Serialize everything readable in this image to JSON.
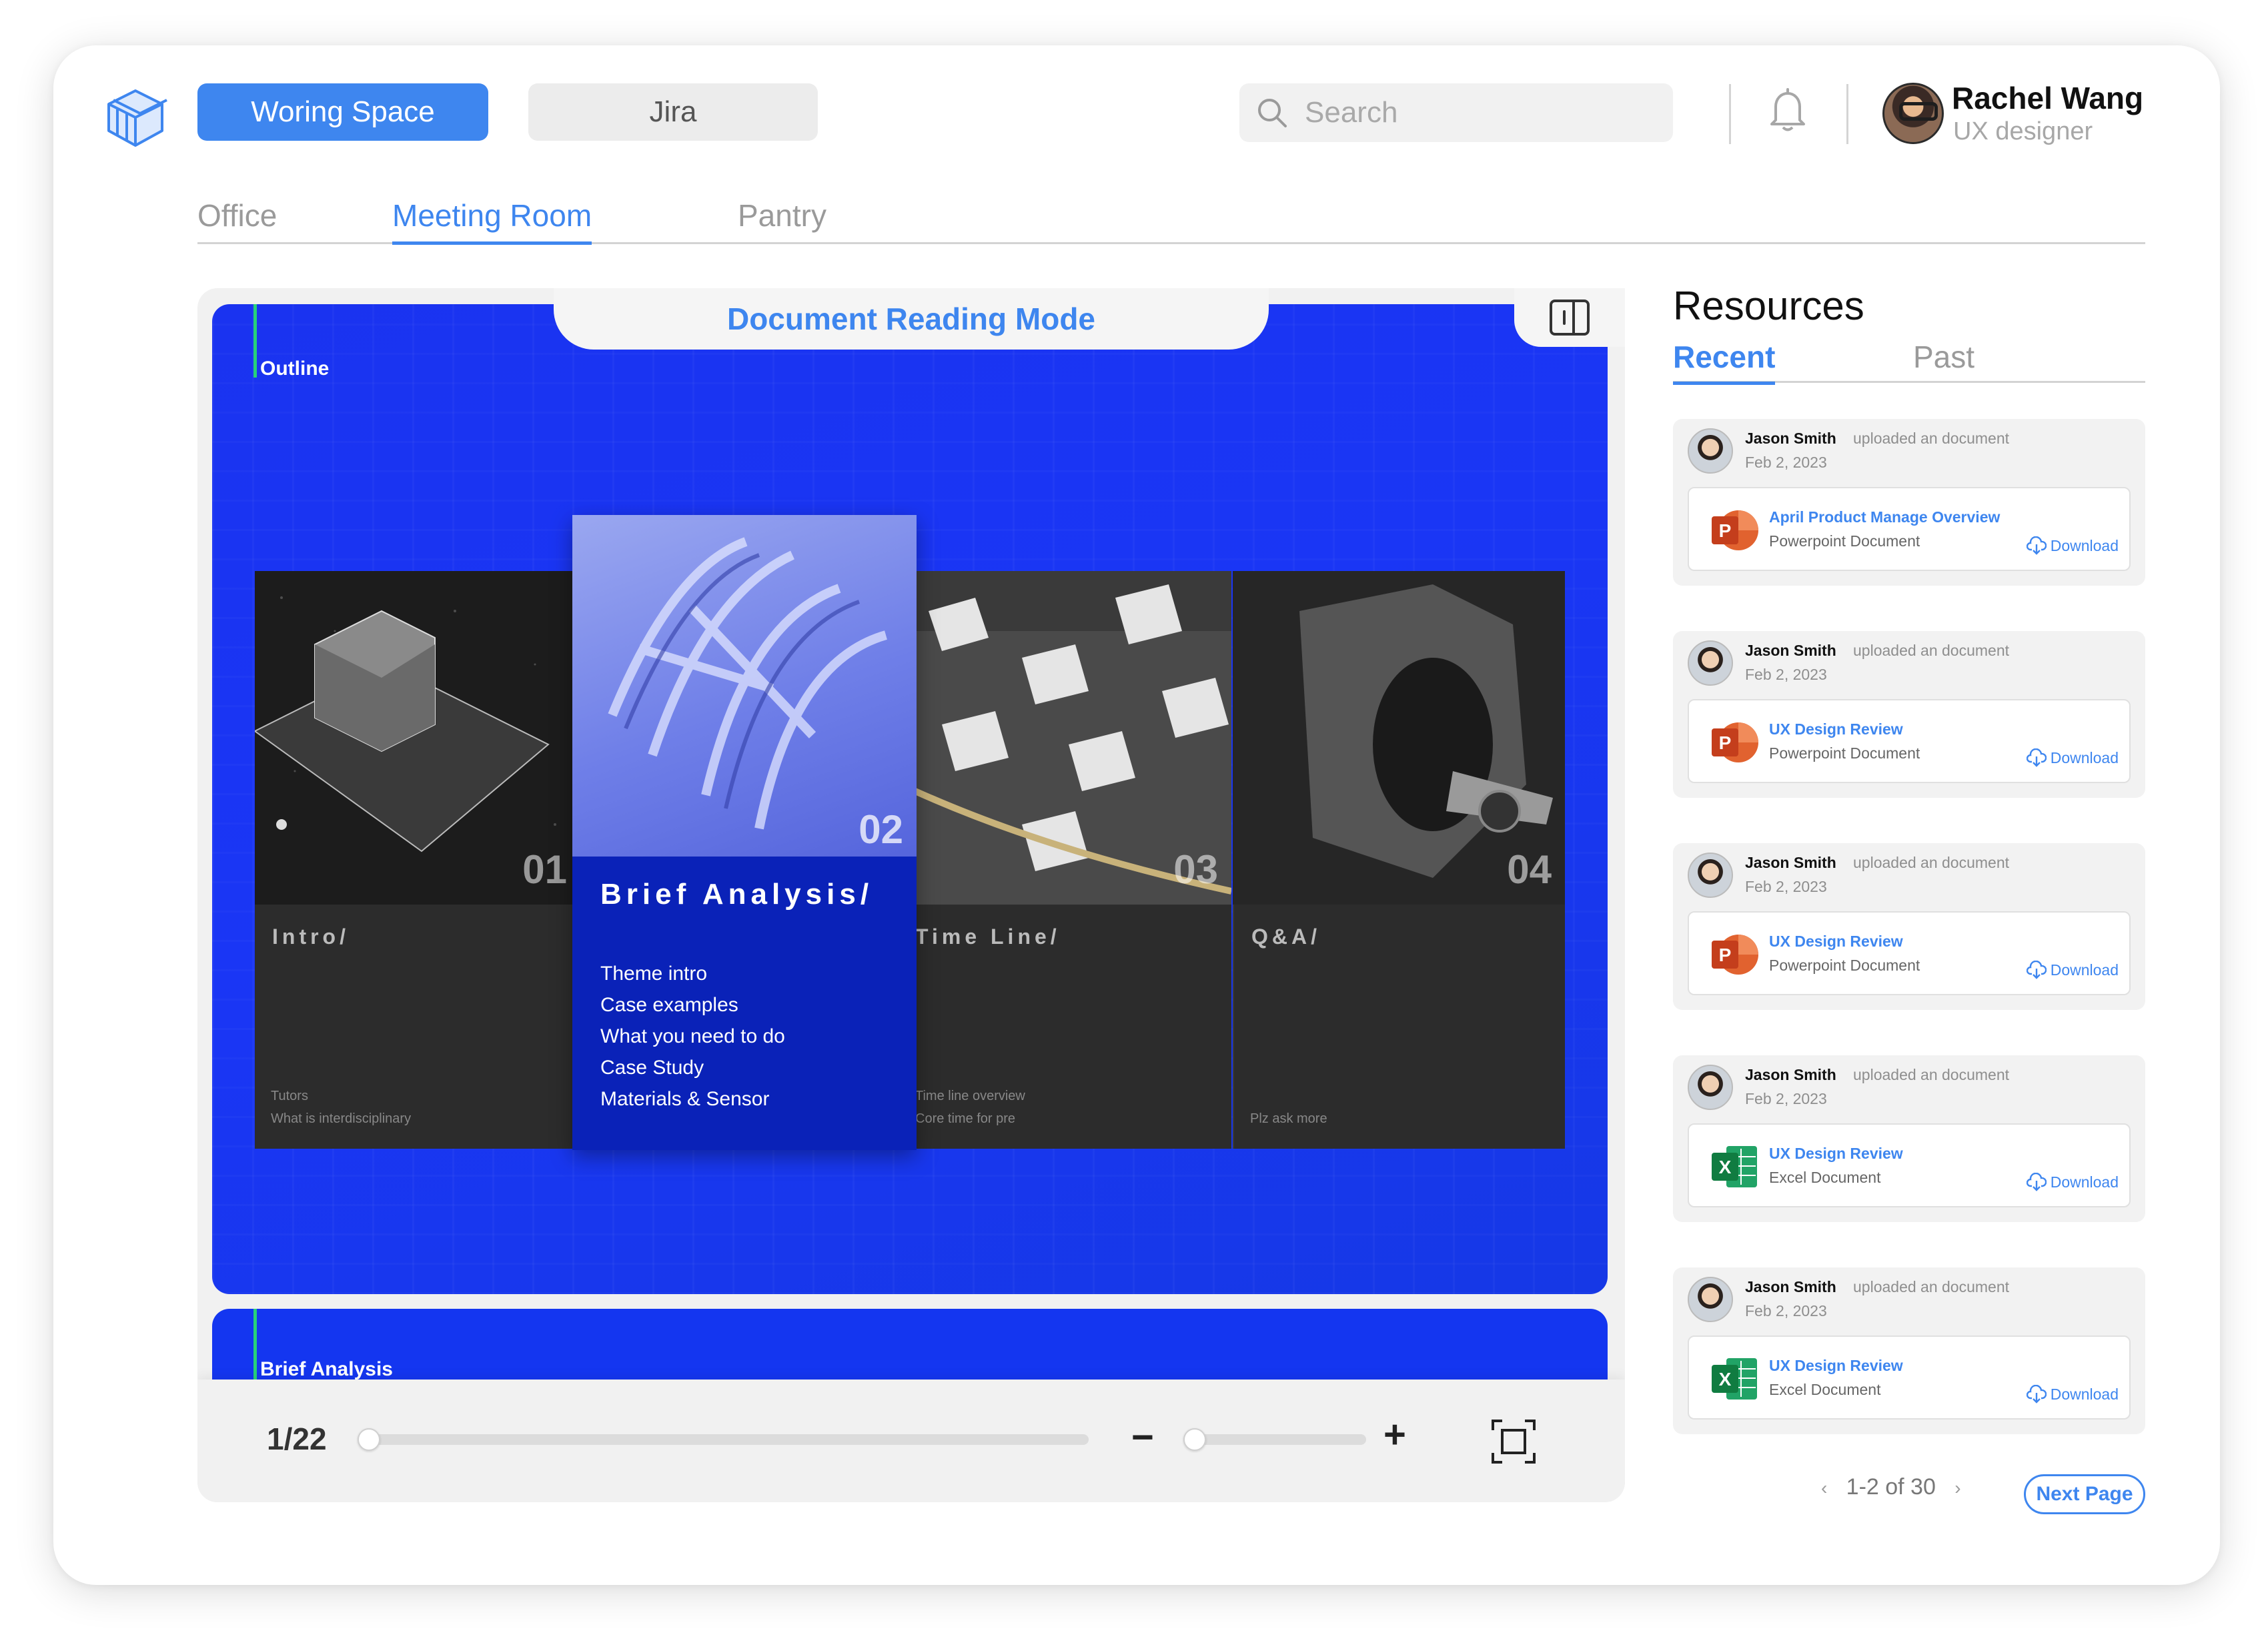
{
  "header": {
    "workspace_label": "Woring Space",
    "jira_label": "Jira",
    "search_placeholder": "Search",
    "user": {
      "name": "Rachel Wang",
      "role": "UX designer"
    }
  },
  "nav": {
    "tabs": [
      {
        "label": "Office",
        "active": false
      },
      {
        "label": "Meeting Room",
        "active": true
      },
      {
        "label": "Pantry",
        "active": false
      }
    ]
  },
  "viewer": {
    "mode_title": "Document Reading Mode",
    "slide1": {
      "outline_label": "Outline",
      "panels": [
        {
          "num": "01",
          "title": "Intro/",
          "lines": [
            "Tutors",
            "What is interdisciplinary"
          ]
        },
        {
          "num": "02",
          "title": "Brief Analysis/",
          "lines": [
            "Theme intro",
            "Case examples",
            "What you need to do",
            "Case Study",
            "Materials & Sensor"
          ]
        },
        {
          "num": "03",
          "title": "Time Line/",
          "lines": [
            "Time line overview",
            "Core time for pre"
          ]
        },
        {
          "num": "04",
          "title": "Q&A/",
          "lines": [
            "Plz ask more"
          ]
        }
      ]
    },
    "slide2_label": "Brief Analysis",
    "controls": {
      "page_indicator": "1/22",
      "progress": 0.0,
      "zoom": 0.0
    }
  },
  "resources": {
    "title": "Resources",
    "tabs": [
      {
        "label": "Recent",
        "active": true
      },
      {
        "label": "Past",
        "active": false
      }
    ],
    "items": [
      {
        "user": "Jason Smith",
        "action": "uploaded an document",
        "date": "Feb 2, 2023",
        "doc_title": "April Product Manage Overview",
        "doc_type": "Powerpoint Document",
        "icon": "powerpoint-icon",
        "download": "Download"
      },
      {
        "user": "Jason Smith",
        "action": "uploaded an document",
        "date": "Feb 2, 2023",
        "doc_title": "UX Design Review",
        "doc_type": "Powerpoint Document",
        "icon": "powerpoint-icon",
        "download": "Download"
      },
      {
        "user": "Jason Smith",
        "action": "uploaded an document",
        "date": "Feb 2, 2023",
        "doc_title": "UX Design Review",
        "doc_type": "Powerpoint Document",
        "icon": "powerpoint-icon",
        "download": "Download"
      },
      {
        "user": "Jason Smith",
        "action": "uploaded an document",
        "date": "Feb 2, 2023",
        "doc_title": "UX Design Review",
        "doc_type": "Excel Document",
        "icon": "excel-icon",
        "download": "Download"
      },
      {
        "user": "Jason Smith",
        "action": "uploaded an document",
        "date": "Feb 2, 2023",
        "doc_title": "UX Design Review",
        "doc_type": "Excel Document",
        "icon": "excel-icon",
        "download": "Download"
      }
    ],
    "pagination": {
      "range": "1-2 of 30",
      "next_label": "Next Page"
    }
  },
  "colors": {
    "accent": "#3e86ef",
    "slide_blue": "#1a36f5",
    "panel_blue": "#0a22b8",
    "powerpoint": "#d24726",
    "excel": "#1d6f42"
  }
}
